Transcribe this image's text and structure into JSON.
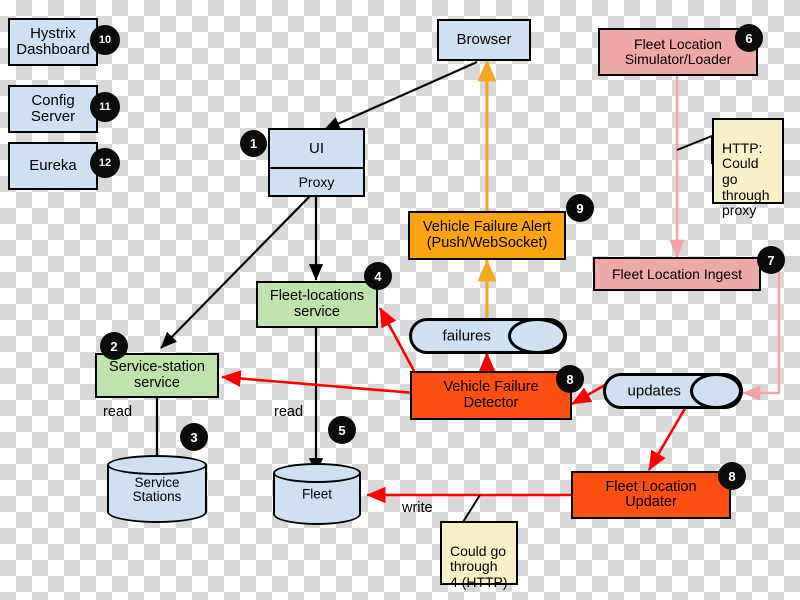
{
  "diagram": {
    "title": "Microservices fleet-management architecture diagram",
    "colors": {
      "blue_fill": "#cfe0f3",
      "green_fill": "#bfe3ac",
      "pink_fill": "#efa8a8",
      "orange_fill": "#fca311",
      "orange_strong_fill": "#fd4f12",
      "note_fill": "#faf0c8",
      "badge_fill": "#0b0b0b",
      "stroke_black": "#000000",
      "stroke_red": "#ff0000",
      "stroke_orange": "#f5a623",
      "stroke_pink": "#f4a0a6"
    },
    "nodes": {
      "hystrix_dashboard": "Hystrix\nDashboard",
      "config_server": "Config\nServer",
      "eureka": "Eureka",
      "browser": "Browser",
      "ui": "UI",
      "ui_proxy": "Proxy",
      "fleet_location_simulator": "Fleet Location\nSimulator/Loader",
      "fleet_location_ingest": "Fleet Location Ingest",
      "vehicle_failure_alert": "Vehicle Failure Alert\n(Push/WebSocket)",
      "failures_queue": "failures",
      "updates_queue": "updates",
      "vehicle_failure_detector": "Vehicle Failure\nDetector",
      "fleet_location_updater": "Fleet Location\nUpdater",
      "fleet_locations_service": "Fleet-locations\nservice",
      "service_station_service": "Service-station\nservice",
      "service_stations_db": "Service\nStations",
      "fleet_db": "Fleet"
    },
    "notes": {
      "http_proxy_note": "HTTP:\nCould go\nthrough\nproxy",
      "write_http_note": "Could go\nthrough\n4 (HTTP)"
    },
    "edge_labels": {
      "read_service_stations": "read",
      "read_fleet": "read",
      "write_fleet": "write"
    },
    "badges": {
      "ui": "1",
      "service_station_service": "2",
      "service_stations_db": "3",
      "fleet_locations_service": "4",
      "fleet_db": "5",
      "fleet_location_simulator": "6",
      "fleet_location_ingest": "7",
      "vehicle_failure_detector": "8",
      "fleet_location_updater": "8",
      "vehicle_failure_alert": "9",
      "hystrix_dashboard": "10",
      "config_server": "11",
      "eureka": "12"
    }
  }
}
